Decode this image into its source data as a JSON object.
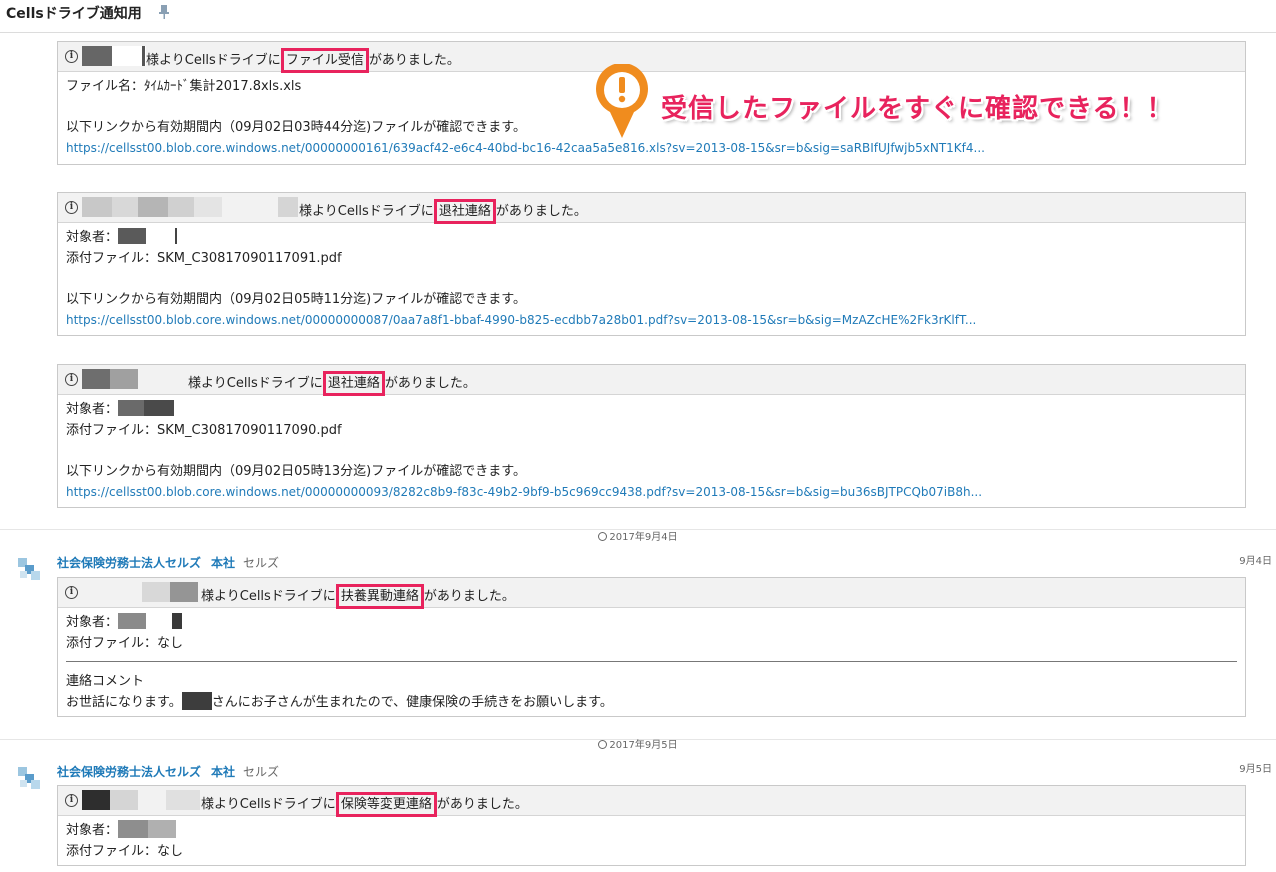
{
  "header": {
    "title": "Cellsドライブ通知用"
  },
  "callout": {
    "text": "受信したファイルをすぐに確認できる！！"
  },
  "notices": [
    {
      "head_pre": "様よりCellsドライブに",
      "head_hl": "ファイル受信",
      "head_post": "がありました。",
      "line1": "ファイル名：ﾀｲﾑｶｰﾄﾞ集計2017.8xls.xls",
      "line3": "以下リンクから有効期間内（09月02日03時44分迄)ファイルが確認できます。",
      "link": "https://cellsst00.blob.core.windows.net/00000000161/639acf42-e6c4-40bd-bc16-42caa5a5e816.xls?sv=2013-08-15&sr=b&sig=saRBIfUJfwjb5xNT1Kf4..."
    },
    {
      "head_pre": "様よりCellsドライブに",
      "head_hl": "退社連絡",
      "head_post": "がありました。",
      "line1": "対象者：",
      "line2": "添付ファイル：SKM_C30817090117091.pdf",
      "line3": "以下リンクから有効期間内（09月02日05時11分迄)ファイルが確認できます。",
      "link": "https://cellsst00.blob.core.windows.net/00000000087/0aa7a8f1-bbaf-4990-b825-ecdbb7a28b01.pdf?sv=2013-08-15&sr=b&sig=MzAZcHE%2Fk3rKlfT..."
    },
    {
      "head_pre": "様よりCellsドライブに",
      "head_hl": "退社連絡",
      "head_post": "がありました。",
      "line1": "対象者：",
      "line2": "添付ファイル：SKM_C30817090117090.pdf",
      "line3": "以下リンクから有効期間内（09月02日05時13分迄)ファイルが確認できます。",
      "link": "https://cellsst00.blob.core.windows.net/00000000093/8282c8b9-f83c-49b2-9bf9-b5c969cc9438.pdf?sv=2013-08-15&sr=b&sig=bu36sBJTPCQb07iB8h..."
    }
  ],
  "date_separators": [
    "2017年9月4日",
    "2017年9月5日"
  ],
  "messages": [
    {
      "sender_org": "社会保険労務士法人セルズ",
      "sender_sub": "本社",
      "sender_who": "セルズ",
      "date": "9月4日",
      "head_pre": "様よりCellsドライブに",
      "head_hl": "扶養異動連絡",
      "head_post": "がありました。",
      "line1": "対象者：",
      "line2": "添付ファイル：なし",
      "comment_label": "連絡コメント",
      "comment_pre": "お世話になります。",
      "comment_post": "さんにお子さんが生まれたので、健康保険の手続きをお願いします。"
    },
    {
      "sender_org": "社会保険労務士法人セルズ",
      "sender_sub": "本社",
      "sender_who": "セルズ",
      "date": "9月5日",
      "head_pre": "様よりCellsドライブに",
      "head_hl": "保険等変更連絡",
      "head_post": "がありました。",
      "line1": "対象者：",
      "line2": "添付ファイル：なし"
    }
  ],
  "colors": {
    "highlight": "#e8235d",
    "link": "#1f7ab8",
    "callout_badge": "#f08c1e"
  },
  "icons": [
    "pin-icon",
    "info-icon",
    "clock-icon",
    "cells-logo-icon",
    "exclamation-icon"
  ]
}
